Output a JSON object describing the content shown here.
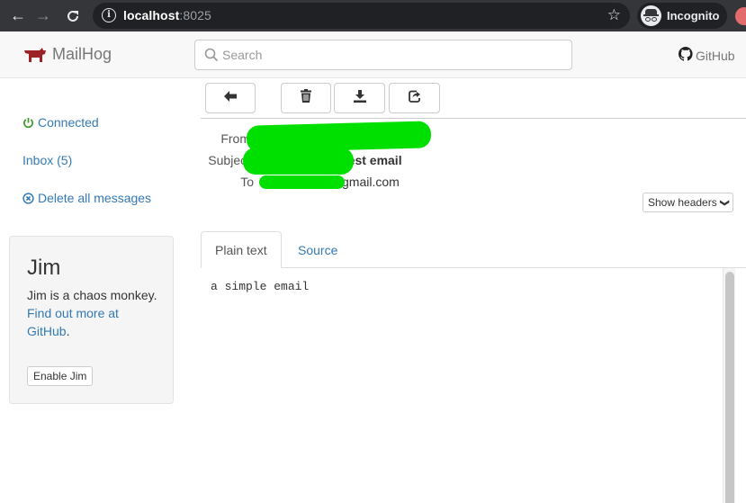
{
  "browser": {
    "url_host": "localhost",
    "url_port": ":8025",
    "profile_label": "Incognito",
    "icons": [
      "back-arrow-icon",
      "forward-arrow-icon",
      "reload-icon",
      "info-icon",
      "star-icon",
      "incognito-icon"
    ]
  },
  "navbar": {
    "brand": "MailHog",
    "search_placeholder": "Search",
    "github_label": "GitHub"
  },
  "sidebar": {
    "connected_label": "Connected",
    "inbox_label": "Inbox (5)",
    "delete_all_label": "Delete all messages",
    "jim": {
      "title": "Jim",
      "description": "Jim is a chaos monkey.",
      "link_text": "Find out more at GitHub",
      "link_suffix": ".",
      "button_label": "Enable Jim"
    }
  },
  "toolbar": {
    "buttons": [
      {
        "name": "back",
        "icon": "arrow-left-icon"
      },
      {
        "name": "delete",
        "icon": "trash-icon"
      },
      {
        "name": "download",
        "icon": "download-icon"
      },
      {
        "name": "release",
        "icon": "share-icon"
      }
    ]
  },
  "message": {
    "from_label": "From",
    "subject_label": "Subject",
    "subject_visible_tail": "test email",
    "to_label": "To",
    "to_visible_tail": "gmail.com",
    "show_headers_label": "Show headers",
    "tabs": [
      {
        "label": "Plain text",
        "active": true
      },
      {
        "label": "Source",
        "active": false
      }
    ],
    "body": "a simple email"
  },
  "colors": {
    "link": "#337ab7",
    "connected": "#3c9a2a",
    "brand_hog": "#9b2226",
    "redaction": "#00e000"
  }
}
